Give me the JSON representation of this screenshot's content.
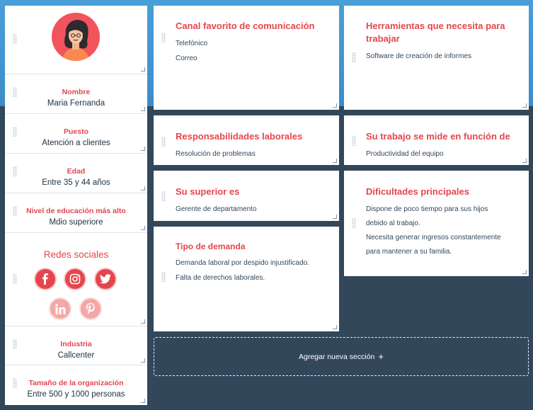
{
  "profile": {
    "avatar_icon": "persona-avatar-icon",
    "fields": [
      {
        "label": "Nombre",
        "value": "Maria Fernanda"
      },
      {
        "label": "Puesto",
        "value": "Atención a clientes"
      },
      {
        "label": "Edad",
        "value": "Entre 35 y 44 años"
      },
      {
        "label": "Nivel de educación más alto",
        "value": "Mdio superiore"
      }
    ],
    "social": {
      "title": "Redes sociales",
      "networks": [
        {
          "icon": "facebook-icon",
          "active": true
        },
        {
          "icon": "instagram-icon",
          "active": true
        },
        {
          "icon": "twitter-icon",
          "active": true
        },
        {
          "icon": "linkedin-icon",
          "active": false
        },
        {
          "icon": "pinterest-icon",
          "active": false
        }
      ]
    },
    "fields_bottom": [
      {
        "label": "Industria",
        "value": "Callcenter"
      },
      {
        "label": "Tamaño de la organización",
        "value": "Entre 500 y 1000 personas"
      }
    ]
  },
  "sections": {
    "channel": {
      "title": "Canal favorito de comunicación",
      "lines": [
        "Telefónico",
        "Correo"
      ]
    },
    "tools": {
      "title_line1": "Herramientas que necesita para",
      "title_line2": "trabajar",
      "lines": [
        "Software de creación de informes"
      ]
    },
    "responsibilities": {
      "title": "Responsabilidades laborales",
      "lines": [
        "Resolución de problemas"
      ]
    },
    "measured": {
      "title": "Su trabajo se mide en función de",
      "lines": [
        "Productividad del equipo"
      ]
    },
    "boss": {
      "title": "Su superior es",
      "lines": [
        "Gerente de departamento"
      ]
    },
    "challenges": {
      "title": "Dificultades principales",
      "lines": [
        "Dispone de poco tiempo para sus hijos",
        "debido al trabajo.",
        "Necesita generar ingresos constantemente",
        "para mantener a su familia."
      ]
    },
    "demand": {
      "title": "Tipo de demanda",
      "lines": [
        "Demanda laboral por despido injustificado.",
        "Falta de derechos laborales."
      ]
    }
  },
  "add_section": {
    "label": "Agregar nueva sección",
    "icon": "plus-icon"
  },
  "colors": {
    "accent": "#e5464d",
    "background": "#33475b",
    "header_blue": "#4a9fd8"
  }
}
